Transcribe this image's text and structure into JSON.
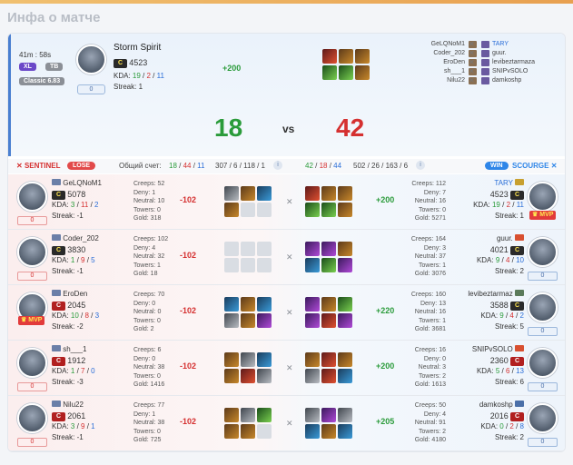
{
  "page_title": "Инфа о матче",
  "hero": {
    "duration": "41m : 58s",
    "tag_xl": "XL",
    "tag_tb": "TB",
    "mode": "Classic 6.83",
    "hero_name": "Storm Spirit",
    "rating": "4523",
    "rank_box": "0",
    "kda_label": "KDA:",
    "kda": [
      "19",
      "2",
      "11"
    ],
    "streak": "Streak: 1",
    "gold_diff": "+200"
  },
  "score": {
    "sentinel": "18",
    "vs": "vs",
    "scourge": "42"
  },
  "players_list": [
    {
      "left": "GeLQNoM1",
      "right": "TARY",
      "highlight": true
    },
    {
      "left": "Coder_202",
      "right": "guur.",
      "highlight": false
    },
    {
      "left": "EroDen",
      "right": "levibeztarmaza",
      "highlight": false
    },
    {
      "left": "sh___1",
      "right": "SNIPvSOLO",
      "highlight": false
    },
    {
      "left": "Nilu22",
      "right": "damkoshp",
      "highlight": false
    }
  ],
  "summary": {
    "sentinel_label": "SENTINEL",
    "lose_label": "LOSE",
    "total_label": "Общий счет:",
    "left_kda": [
      "18",
      "44",
      "11"
    ],
    "left_totals": "307 / 6 / 118 / 1",
    "right_kda": [
      "42",
      "18",
      "44"
    ],
    "right_totals": "502 / 26 / 163 / 6",
    "win_label": "WIN",
    "scourge_label": "SCOURGE"
  },
  "rows": [
    {
      "l": {
        "name": "GeLQNoM1",
        "rating": "5078",
        "kda": [
          "3",
          "11",
          "2"
        ],
        "streak": "Streak: -1",
        "box": "0",
        "mvp": false
      },
      "l_stats": [
        "Creeps: 52",
        "Deny: 1",
        "Neutral: 10",
        "Towers: 0",
        "Gold: 318"
      ],
      "l_diff": "-102",
      "r_diff": "+200",
      "r_stats": [
        "Creeps: 112",
        "Deny: 7",
        "Neutral: 16",
        "Towers: 0",
        "Gold: 5271"
      ],
      "r": {
        "name": "TARY",
        "rating": "4523",
        "kda": [
          "19",
          "2",
          "11"
        ],
        "streak": "Streak: 1",
        "box": "0",
        "mvp": true
      }
    },
    {
      "l": {
        "name": "Coder_202",
        "rating": "3830",
        "kda": [
          "1",
          "9",
          "5"
        ],
        "streak": "Streak: -1",
        "box": "0",
        "mvp": false
      },
      "l_stats": [
        "Creeps: 102",
        "Deny: 4",
        "Neutral: 32",
        "Towers: 1",
        "Gold: 18"
      ],
      "l_diff": "-102",
      "r_diff": "",
      "r_stats": [
        "Creeps: 164",
        "Deny: 3",
        "Neutral: 37",
        "Towers: 1",
        "Gold: 3076"
      ],
      "r": {
        "name": "guur.",
        "rating": "4021",
        "kda": [
          "9",
          "4",
          "10"
        ],
        "streak": "Streak: 2",
        "box": "0",
        "mvp": false
      }
    },
    {
      "l": {
        "name": "EroDen",
        "rating": "2045",
        "kda": [
          "10",
          "8",
          "3"
        ],
        "streak": "Streak: -2",
        "box": "",
        "mvp": true
      },
      "l_stats": [
        "Creeps: 70",
        "Deny: 0",
        "Neutral: 0",
        "Towers: 0",
        "Gold: 2"
      ],
      "l_diff": "-102",
      "r_diff": "+220",
      "r_stats": [
        "Creeps: 160",
        "Deny: 13",
        "Neutral: 16",
        "Towers: 1",
        "Gold: 3681"
      ],
      "r": {
        "name": "levibeztarmaz",
        "rating": "3588",
        "kda": [
          "9",
          "4",
          "2"
        ],
        "streak": "Streak: 5",
        "box": "0",
        "mvp": false
      }
    },
    {
      "l": {
        "name": "sh___1",
        "rating": "1912",
        "kda": [
          "1",
          "7",
          "0"
        ],
        "streak": "Streak: -3",
        "box": "0",
        "mvp": false
      },
      "l_stats": [
        "Creeps: 6",
        "Deny: 0",
        "Neutral: 38",
        "Towers: 0",
        "Gold: 1416"
      ],
      "l_diff": "-102",
      "r_diff": "+200",
      "r_stats": [
        "Creeps: 16",
        "Deny: 0",
        "Neutral: 3",
        "Towers: 2",
        "Gold: 1613"
      ],
      "r": {
        "name": "SNIPvSOLO",
        "rating": "2360",
        "kda": [
          "5",
          "6",
          "13"
        ],
        "streak": "Streak: 6",
        "box": "0",
        "mvp": false
      }
    },
    {
      "l": {
        "name": "Nilu22",
        "rating": "2061",
        "kda": [
          "3",
          "9",
          "1"
        ],
        "streak": "Streak: -1",
        "box": "0",
        "mvp": false
      },
      "l_stats": [
        "Creeps: 77",
        "Deny: 1",
        "Neutral: 38",
        "Towers: 0",
        "Gold: 725"
      ],
      "l_diff": "-102",
      "r_diff": "+205",
      "r_stats": [
        "Creeps: 50",
        "Deny: 4",
        "Neutral: 91",
        "Towers: 2",
        "Gold: 4180"
      ],
      "r": {
        "name": "damkoshp",
        "rating": "2016",
        "kda": [
          "0",
          "2",
          "8"
        ],
        "streak": "Streak: 2",
        "box": "0",
        "mvp": false
      }
    }
  ],
  "mvp_label": "MVP",
  "c_badge": "C",
  "colors": {
    "kills": "#2a9b3a",
    "deaths": "#d53030",
    "assists": "#2a6ed8",
    "accent": "#2f86e8",
    "lose": "#e24a4a"
  }
}
